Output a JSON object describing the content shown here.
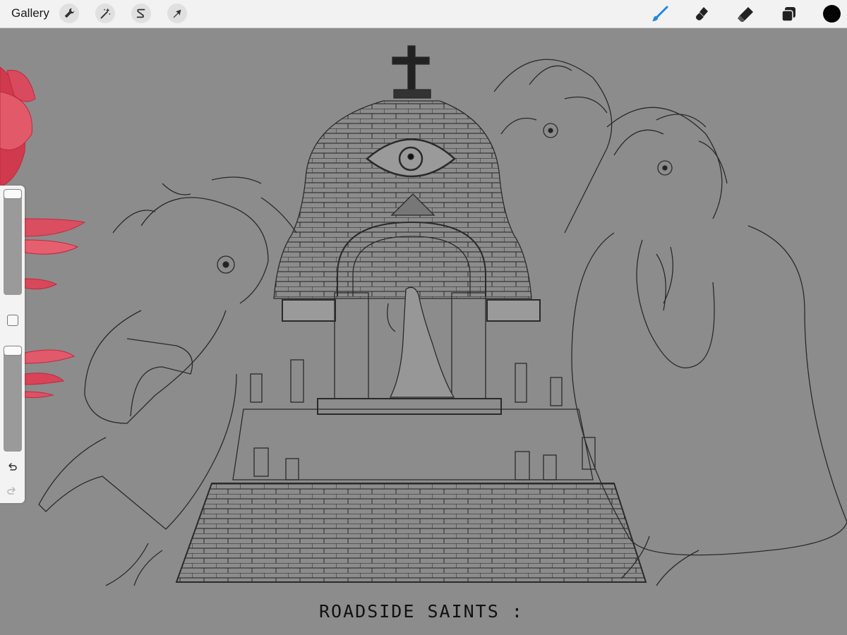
{
  "toolbar": {
    "gallery_label": "Gallery",
    "left_tools": [
      "wrench-icon",
      "magic-wand-icon",
      "selection-icon",
      "transform-arrow-icon"
    ],
    "right_tools": [
      "brush-icon",
      "smudge-icon",
      "eraser-icon",
      "layers-icon"
    ],
    "active_tool": "brush-icon",
    "active_color": "#050505",
    "accent_color": "#1e88e5"
  },
  "sidebar": {
    "brush_size_level": 1.0,
    "opacity_level": 1.0,
    "undo_icon": "undo-icon",
    "redo_icon": "redo-icon",
    "modify_icon": "square-modify-icon"
  },
  "canvas": {
    "background_color": "#8c8c8c",
    "caption": "ROADSIDE SAINTS :"
  }
}
